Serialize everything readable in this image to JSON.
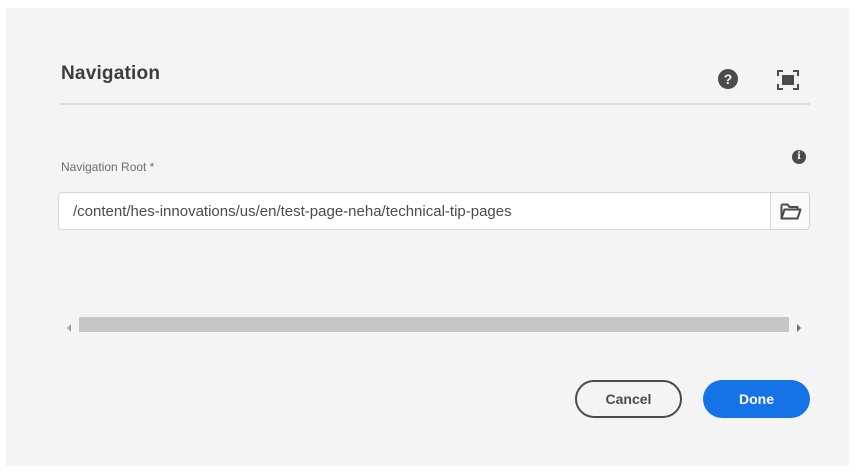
{
  "dialog": {
    "title": "Navigation",
    "help_icon_glyph": "?",
    "icons": {
      "help": "help-circle-icon",
      "fullscreen": "fullscreen-icon",
      "info": "info-icon",
      "browse": "folder-open-icon",
      "scroll_left": "arrow-left-icon",
      "scroll_right": "arrow-right-icon"
    }
  },
  "field": {
    "label": "Navigation Root *",
    "info_glyph": "i",
    "value": "/content/hes-innovations/us/en/test-page-neha/technical-tip-pages"
  },
  "footer": {
    "cancel_label": "Cancel",
    "done_label": "Done"
  },
  "colors": {
    "dialog_background": "#f4f4f4",
    "primary": "#1473e6",
    "text": "#4b4b4b",
    "scrollbar": "#c6c6c6"
  }
}
